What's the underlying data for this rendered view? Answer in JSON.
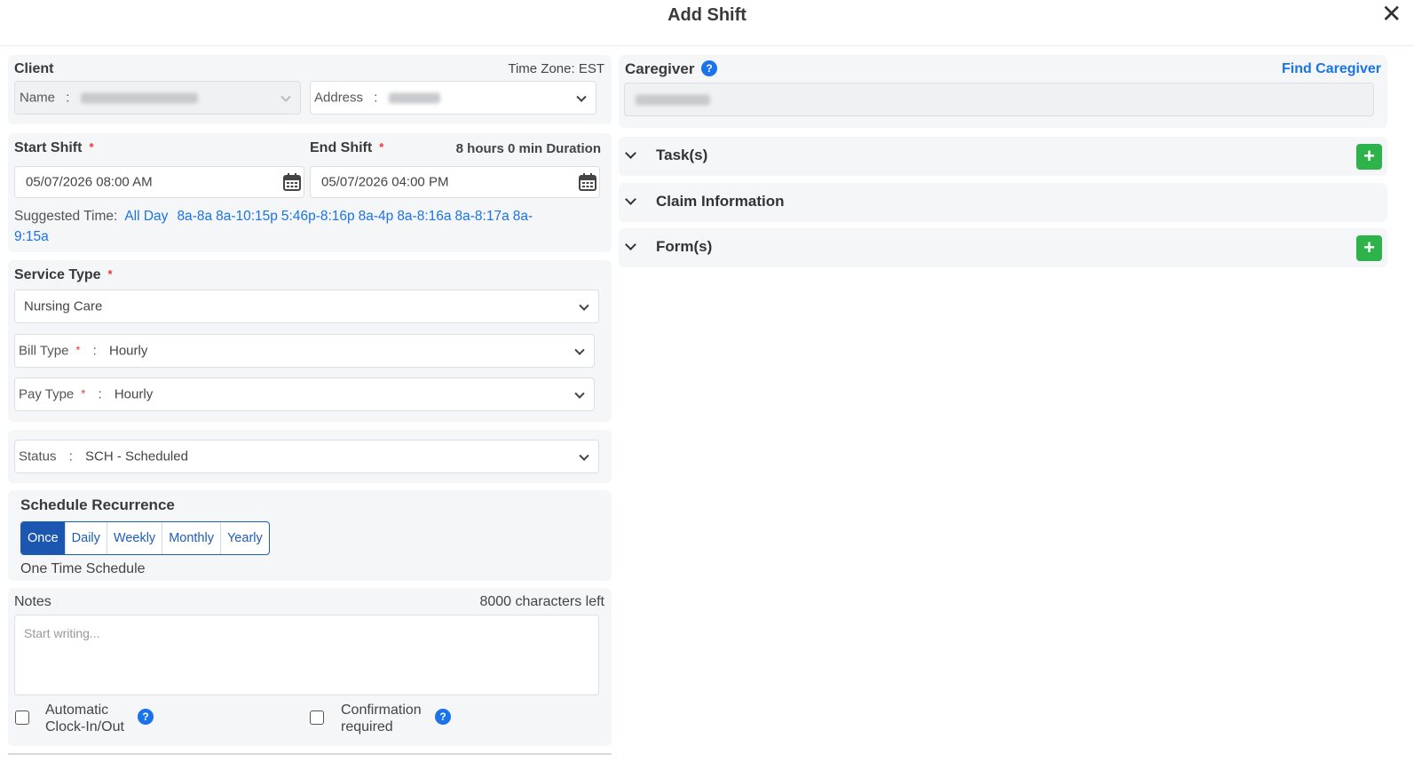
{
  "dialog": {
    "title": "Add Shift"
  },
  "client": {
    "label": "Client",
    "time_zone": "Time Zone: EST",
    "name_label": "Name",
    "address_label": "Address",
    "separator": ":"
  },
  "shift": {
    "start_label": "Start Shift",
    "end_label": "End Shift",
    "duration": "8 hours 0 min Duration",
    "start_value": "05/07/2026 08:00 AM",
    "end_value": "05/07/2026 04:00 PM",
    "suggested_label": "Suggested Time:",
    "suggested_times": [
      "All Day",
      "8a-8a",
      "8a-10:15p",
      "5:46p-8:16p",
      "8a-4p",
      "8a-8:16a",
      "8a-8:17a",
      "8a-9:15a"
    ]
  },
  "service": {
    "label": "Service Type",
    "value": "Nursing Care",
    "bill_type_label": "Bill Type",
    "bill_type_value": "Hourly",
    "pay_type_label": "Pay Type",
    "pay_type_value": "Hourly"
  },
  "status": {
    "label": "Status",
    "value": "SCH - Scheduled"
  },
  "recurrence": {
    "title": "Schedule Recurrence",
    "options": [
      "Once",
      "Daily",
      "Weekly",
      "Monthly",
      "Yearly"
    ],
    "selected": "Once",
    "description": "One Time Schedule"
  },
  "notes": {
    "label": "Notes",
    "chars_left": "8000 characters left",
    "placeholder": "Start writing..."
  },
  "options": {
    "auto_clock_line1": "Automatic",
    "auto_clock_line2": "Clock-In/Out",
    "confirmation_line1": "Confirmation",
    "confirmation_line2": "required"
  },
  "caregiver": {
    "label": "Caregiver",
    "find_link": "Find Caregiver"
  },
  "sections": {
    "tasks": "Task(s)",
    "claim": "Claim Information",
    "forms": "Form(s)"
  },
  "icons": {
    "close": "close-icon",
    "calendar": "calendar-icon",
    "help": "help-icon",
    "chevron": "chevron-down-icon",
    "plus": "plus-icon"
  },
  "colors": {
    "primary": "#1b57b0",
    "link": "#1a73e8",
    "required": "#e53935",
    "add_green": "#2db34a"
  }
}
